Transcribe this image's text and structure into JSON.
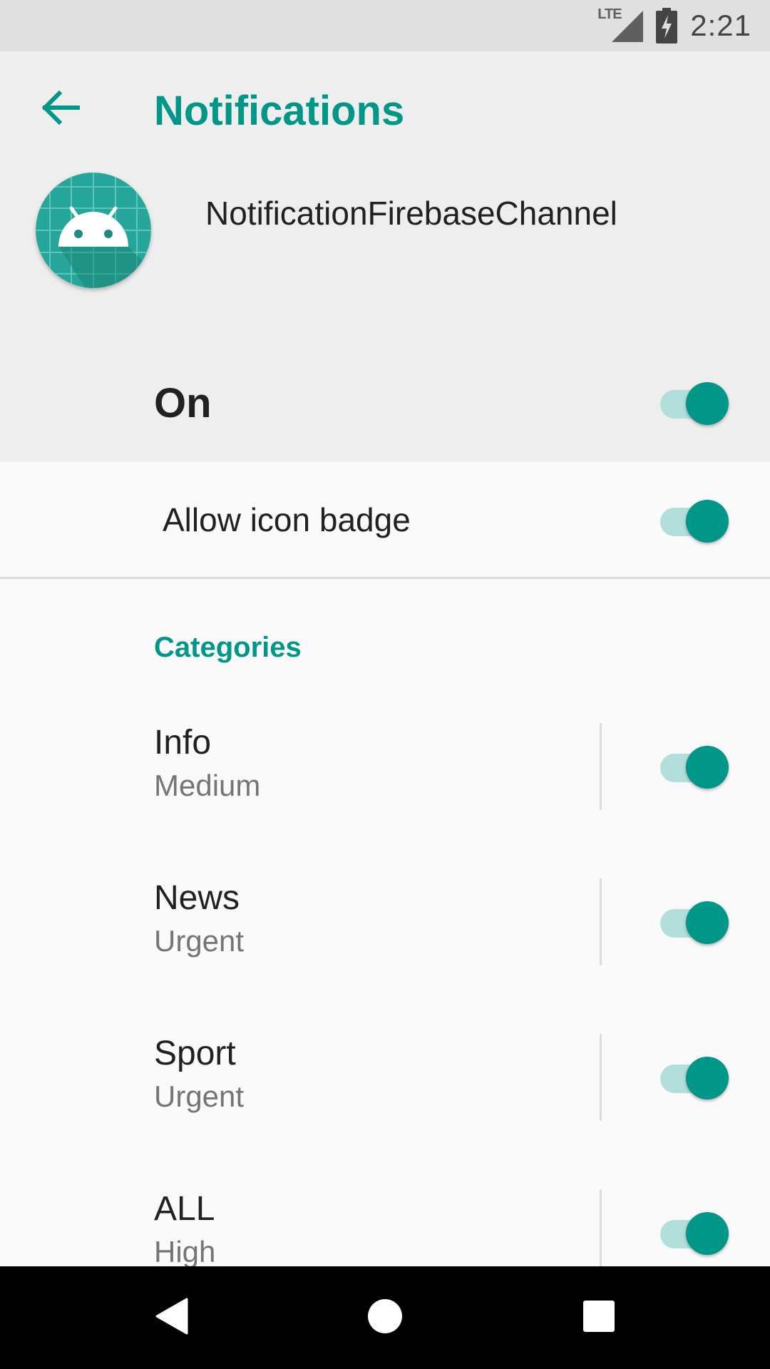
{
  "status_bar": {
    "network": "LTE",
    "time": "2:21"
  },
  "header": {
    "title": "Notifications",
    "app_name": "NotificationFirebaseChannel",
    "master_switch": {
      "label": "On",
      "checked": true
    }
  },
  "settings": {
    "allow_icon_badge": {
      "label": "Allow icon badge",
      "checked": true
    }
  },
  "categories": {
    "header": "Categories",
    "items": [
      {
        "title": "Info",
        "importance": "Medium",
        "checked": true
      },
      {
        "title": "News",
        "importance": "Urgent",
        "checked": true
      },
      {
        "title": "Sport",
        "importance": "Urgent",
        "checked": true
      },
      {
        "title": "ALL",
        "importance": "High",
        "checked": true
      }
    ]
  },
  "colors": {
    "accent": "#009688",
    "accent_light": "#b2dfdb",
    "header_bg": "#eeeeee",
    "status_bar_bg": "#e0e0e0",
    "nav_bar_bg": "#000000"
  },
  "icons": {
    "back": "arrow-back-icon",
    "app": "android-icon",
    "signal": "signal-icon",
    "battery": "battery-charging-icon",
    "nav_back": "nav-back-icon",
    "nav_home": "nav-home-icon",
    "nav_recents": "nav-recents-icon"
  }
}
